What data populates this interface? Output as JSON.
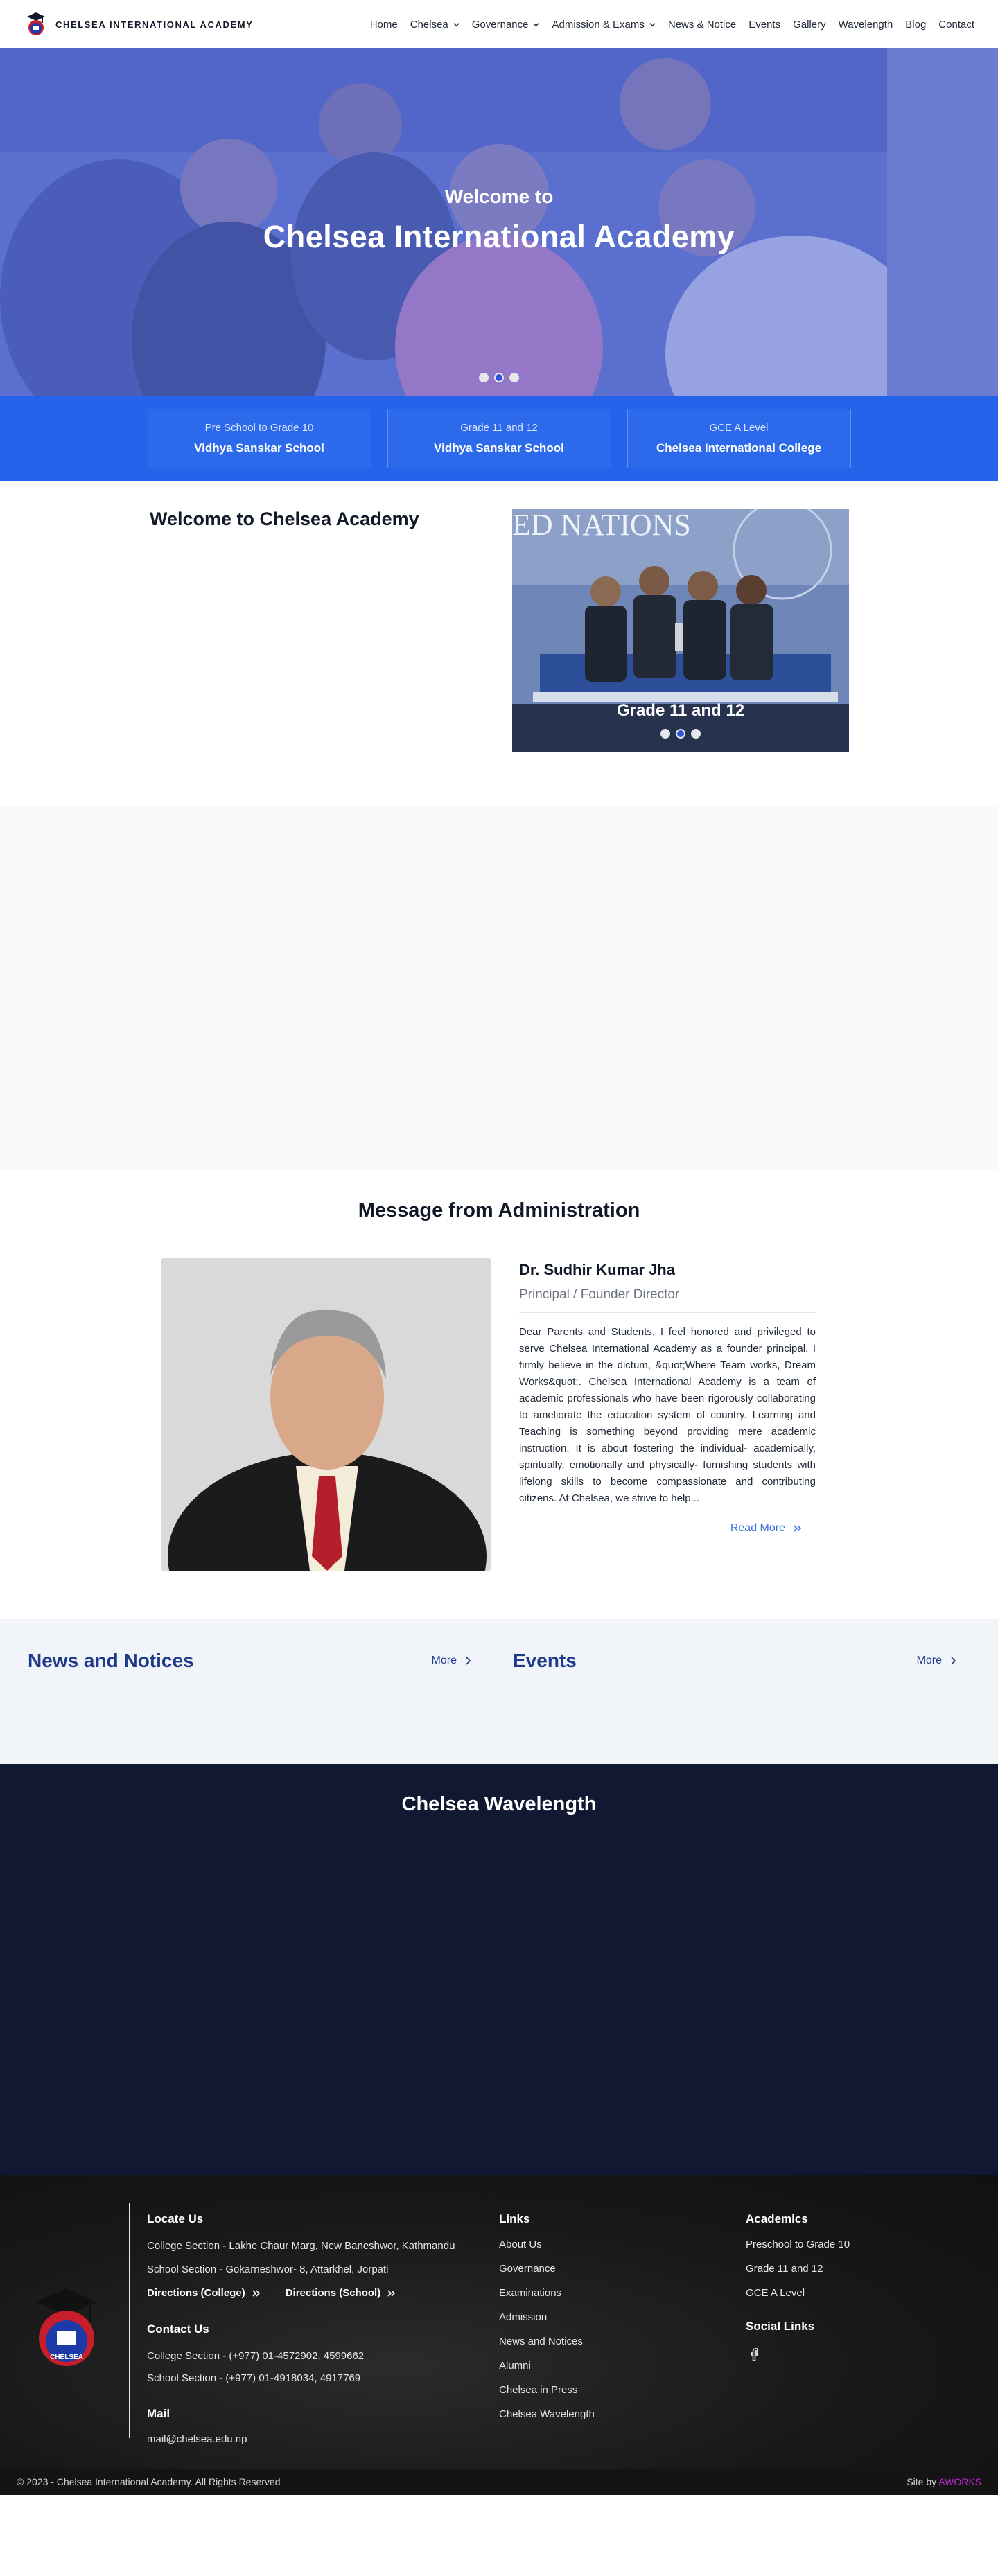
{
  "brand": {
    "name": "CHELSEA INTERNATIONAL ACADEMY"
  },
  "nav": {
    "items": [
      {
        "label": "Home"
      },
      {
        "label": "Chelsea",
        "dropdown": true
      },
      {
        "label": "Governance",
        "dropdown": true
      },
      {
        "label": "Admission & Exams",
        "dropdown": true
      },
      {
        "label": "News & Notice"
      },
      {
        "label": "Events"
      },
      {
        "label": "Gallery"
      },
      {
        "label": "Wavelength"
      },
      {
        "label": "Blog"
      },
      {
        "label": "Contact"
      }
    ]
  },
  "hero": {
    "subtitle": "Welcome to",
    "title": "Chelsea International Academy",
    "slides": 3,
    "active_slide": 2
  },
  "levels": [
    {
      "top": "Pre School to Grade 10",
      "bottom": "Vidhya Sanskar School"
    },
    {
      "top": "Grade 11 and 12",
      "bottom": "Vidhya Sanskar School"
    },
    {
      "top": "GCE A Level",
      "bottom": "Chelsea International College"
    }
  ],
  "welcome": {
    "title": "Welcome to Chelsea Academy",
    "carousel_caption": "Grade 11 and 12",
    "carousel_banner": "ED NATIONS",
    "slides": 3,
    "active_slide": 2
  },
  "message": {
    "heading": "Message from Administration",
    "name": "Dr. Sudhir Kumar Jha",
    "role": "Principal / Founder Director",
    "text": "Dear Parents and Students, I feel honored and privileged to serve Chelsea International Academy as a founder principal. I firmly believe in the dictum, &quot;Where Team works, Dream Works&quot;. Chelsea International Academy is a team of academic professionals who have been rigorously collaborating to ameliorate the education system of country. Learning and Teaching is something beyond providing mere academic instruction. It is about fostering the individual- academically, spiritually, emotionally and physically- furnishing students with lifelong skills to become compassionate and contributing citizens. At Chelsea, we strive to help...",
    "read_more": "Read More"
  },
  "news": {
    "news_title": "News and Notices",
    "events_title": "Events",
    "more": "More"
  },
  "wavelength": {
    "title": "Chelsea Wavelength"
  },
  "footer": {
    "locate": {
      "heading": "Locate Us",
      "college": "College Section - Lakhe Chaur Marg, New Baneshwor, Kathmandu",
      "school": "School Section - Gokarneshwor- 8, Attarkhel, Jorpati",
      "dir_college": "Directions (College)",
      "dir_school": "Directions (School)"
    },
    "contact": {
      "heading": "Contact Us",
      "college": "College Section - (+977) 01-4572902, 4599662",
      "school": "School Section - (+977) 01-4918034, 4917769"
    },
    "mail": {
      "heading": "Mail",
      "address": "mail@chelsea.edu.np"
    },
    "links": {
      "heading": "Links",
      "items": [
        "About Us",
        "Governance",
        "Examinations",
        "Admission",
        "News and Notices",
        "Alumni",
        "Chelsea in Press",
        "Chelsea Wavelength"
      ]
    },
    "academics": {
      "heading": "Academics",
      "items": [
        "Preschool to Grade 10",
        "Grade 11 and 12",
        "GCE A Level"
      ]
    },
    "social": {
      "heading": "Social Links",
      "icon": "facebook-icon"
    },
    "logo_text": "CHELSEA",
    "copyright": "© 2023 - Chelsea International Academy. All Rights Reserved",
    "site_by": "Site by",
    "site_by_name": "AWORKS"
  },
  "colors": {
    "accent": "#2563eb",
    "navy": "#1e3a8a",
    "wave_bg": "#111832",
    "aworks": "#c026d3"
  }
}
